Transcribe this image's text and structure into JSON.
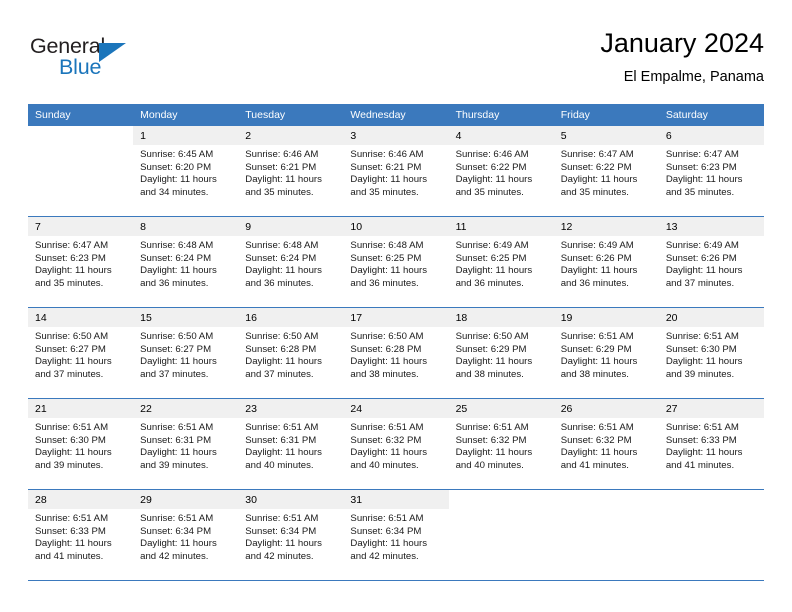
{
  "brand": {
    "name_part1": "General",
    "name_part2": "Blue",
    "accent_color": "#1b75bb"
  },
  "header": {
    "title": "January 2024",
    "location": "El Empalme, Panama"
  },
  "calendar": {
    "header_color": "#3b79bd",
    "weekday_headers": [
      "Sunday",
      "Monday",
      "Tuesday",
      "Wednesday",
      "Thursday",
      "Friday",
      "Saturday"
    ],
    "labels": {
      "sunrise": "Sunrise:",
      "sunset": "Sunset:",
      "daylight": "Daylight:"
    },
    "weeks": [
      [
        {
          "empty": true
        },
        {
          "day": "1",
          "sunrise": "Sunrise: 6:45 AM",
          "sunset": "Sunset: 6:20 PM",
          "daylight": "Daylight: 11 hours and 34 minutes."
        },
        {
          "day": "2",
          "sunrise": "Sunrise: 6:46 AM",
          "sunset": "Sunset: 6:21 PM",
          "daylight": "Daylight: 11 hours and 35 minutes."
        },
        {
          "day": "3",
          "sunrise": "Sunrise: 6:46 AM",
          "sunset": "Sunset: 6:21 PM",
          "daylight": "Daylight: 11 hours and 35 minutes."
        },
        {
          "day": "4",
          "sunrise": "Sunrise: 6:46 AM",
          "sunset": "Sunset: 6:22 PM",
          "daylight": "Daylight: 11 hours and 35 minutes."
        },
        {
          "day": "5",
          "sunrise": "Sunrise: 6:47 AM",
          "sunset": "Sunset: 6:22 PM",
          "daylight": "Daylight: 11 hours and 35 minutes."
        },
        {
          "day": "6",
          "sunrise": "Sunrise: 6:47 AM",
          "sunset": "Sunset: 6:23 PM",
          "daylight": "Daylight: 11 hours and 35 minutes."
        }
      ],
      [
        {
          "day": "7",
          "sunrise": "Sunrise: 6:47 AM",
          "sunset": "Sunset: 6:23 PM",
          "daylight": "Daylight: 11 hours and 35 minutes."
        },
        {
          "day": "8",
          "sunrise": "Sunrise: 6:48 AM",
          "sunset": "Sunset: 6:24 PM",
          "daylight": "Daylight: 11 hours and 36 minutes."
        },
        {
          "day": "9",
          "sunrise": "Sunrise: 6:48 AM",
          "sunset": "Sunset: 6:24 PM",
          "daylight": "Daylight: 11 hours and 36 minutes."
        },
        {
          "day": "10",
          "sunrise": "Sunrise: 6:48 AM",
          "sunset": "Sunset: 6:25 PM",
          "daylight": "Daylight: 11 hours and 36 minutes."
        },
        {
          "day": "11",
          "sunrise": "Sunrise: 6:49 AM",
          "sunset": "Sunset: 6:25 PM",
          "daylight": "Daylight: 11 hours and 36 minutes."
        },
        {
          "day": "12",
          "sunrise": "Sunrise: 6:49 AM",
          "sunset": "Sunset: 6:26 PM",
          "daylight": "Daylight: 11 hours and 36 minutes."
        },
        {
          "day": "13",
          "sunrise": "Sunrise: 6:49 AM",
          "sunset": "Sunset: 6:26 PM",
          "daylight": "Daylight: 11 hours and 37 minutes."
        }
      ],
      [
        {
          "day": "14",
          "sunrise": "Sunrise: 6:50 AM",
          "sunset": "Sunset: 6:27 PM",
          "daylight": "Daylight: 11 hours and 37 minutes."
        },
        {
          "day": "15",
          "sunrise": "Sunrise: 6:50 AM",
          "sunset": "Sunset: 6:27 PM",
          "daylight": "Daylight: 11 hours and 37 minutes."
        },
        {
          "day": "16",
          "sunrise": "Sunrise: 6:50 AM",
          "sunset": "Sunset: 6:28 PM",
          "daylight": "Daylight: 11 hours and 37 minutes."
        },
        {
          "day": "17",
          "sunrise": "Sunrise: 6:50 AM",
          "sunset": "Sunset: 6:28 PM",
          "daylight": "Daylight: 11 hours and 38 minutes."
        },
        {
          "day": "18",
          "sunrise": "Sunrise: 6:50 AM",
          "sunset": "Sunset: 6:29 PM",
          "daylight": "Daylight: 11 hours and 38 minutes."
        },
        {
          "day": "19",
          "sunrise": "Sunrise: 6:51 AM",
          "sunset": "Sunset: 6:29 PM",
          "daylight": "Daylight: 11 hours and 38 minutes."
        },
        {
          "day": "20",
          "sunrise": "Sunrise: 6:51 AM",
          "sunset": "Sunset: 6:30 PM",
          "daylight": "Daylight: 11 hours and 39 minutes."
        }
      ],
      [
        {
          "day": "21",
          "sunrise": "Sunrise: 6:51 AM",
          "sunset": "Sunset: 6:30 PM",
          "daylight": "Daylight: 11 hours and 39 minutes."
        },
        {
          "day": "22",
          "sunrise": "Sunrise: 6:51 AM",
          "sunset": "Sunset: 6:31 PM",
          "daylight": "Daylight: 11 hours and 39 minutes."
        },
        {
          "day": "23",
          "sunrise": "Sunrise: 6:51 AM",
          "sunset": "Sunset: 6:31 PM",
          "daylight": "Daylight: 11 hours and 40 minutes."
        },
        {
          "day": "24",
          "sunrise": "Sunrise: 6:51 AM",
          "sunset": "Sunset: 6:32 PM",
          "daylight": "Daylight: 11 hours and 40 minutes."
        },
        {
          "day": "25",
          "sunrise": "Sunrise: 6:51 AM",
          "sunset": "Sunset: 6:32 PM",
          "daylight": "Daylight: 11 hours and 40 minutes."
        },
        {
          "day": "26",
          "sunrise": "Sunrise: 6:51 AM",
          "sunset": "Sunset: 6:32 PM",
          "daylight": "Daylight: 11 hours and 41 minutes."
        },
        {
          "day": "27",
          "sunrise": "Sunrise: 6:51 AM",
          "sunset": "Sunset: 6:33 PM",
          "daylight": "Daylight: 11 hours and 41 minutes."
        }
      ],
      [
        {
          "day": "28",
          "sunrise": "Sunrise: 6:51 AM",
          "sunset": "Sunset: 6:33 PM",
          "daylight": "Daylight: 11 hours and 41 minutes."
        },
        {
          "day": "29",
          "sunrise": "Sunrise: 6:51 AM",
          "sunset": "Sunset: 6:34 PM",
          "daylight": "Daylight: 11 hours and 42 minutes."
        },
        {
          "day": "30",
          "sunrise": "Sunrise: 6:51 AM",
          "sunset": "Sunset: 6:34 PM",
          "daylight": "Daylight: 11 hours and 42 minutes."
        },
        {
          "day": "31",
          "sunrise": "Sunrise: 6:51 AM",
          "sunset": "Sunset: 6:34 PM",
          "daylight": "Daylight: 11 hours and 42 minutes."
        },
        {
          "empty": true
        },
        {
          "empty": true
        },
        {
          "empty": true
        }
      ]
    ]
  }
}
